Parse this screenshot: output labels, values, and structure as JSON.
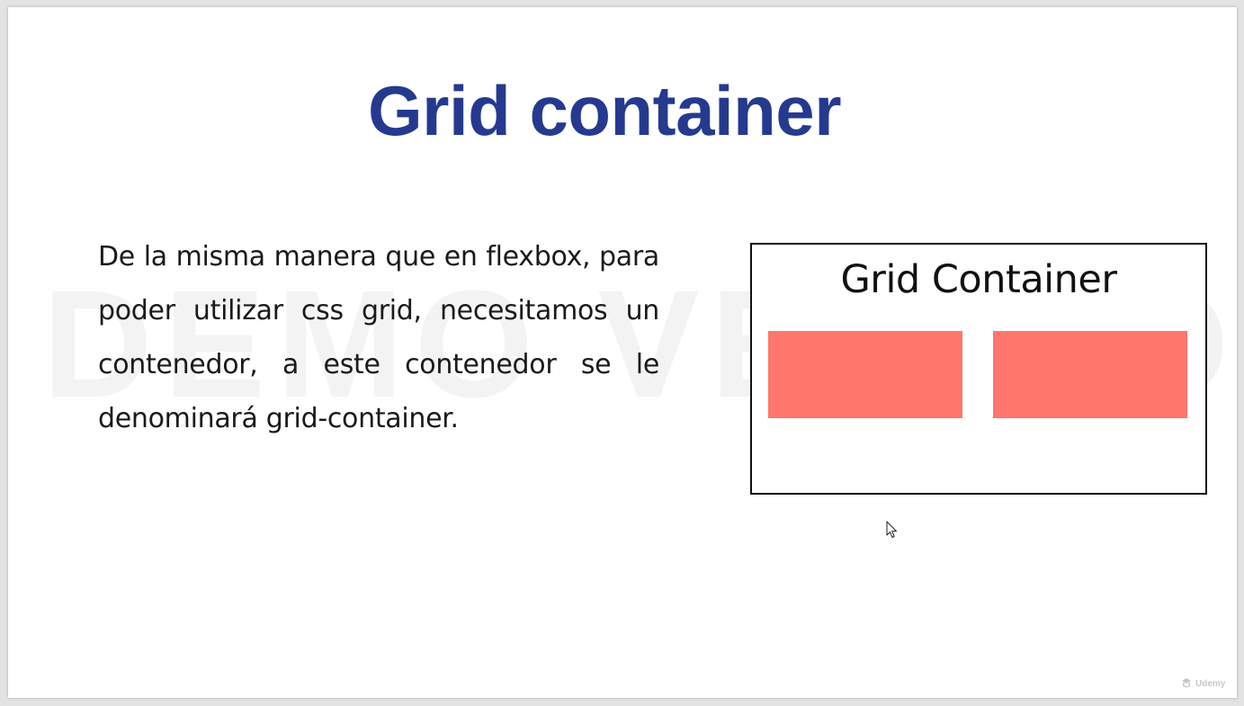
{
  "watermark": {
    "text": "DEMO VERSION"
  },
  "slide": {
    "title": "Grid container",
    "body": "De la misma manera que en flexbox, para poder utilizar css grid, necesitamos un contenedor, a este contenedor se le denominará grid-container."
  },
  "diagram": {
    "title": "Grid Container",
    "item_color": "#fe766c",
    "item_count": 2
  },
  "brand": {
    "name": "Udemy"
  },
  "colors": {
    "title": "#253a8f",
    "body_text": "#1a1a1a",
    "background": "#ffffff"
  },
  "icons": {
    "cursor": "mouse-pointer-icon",
    "brand": "udemy-logo-icon"
  }
}
